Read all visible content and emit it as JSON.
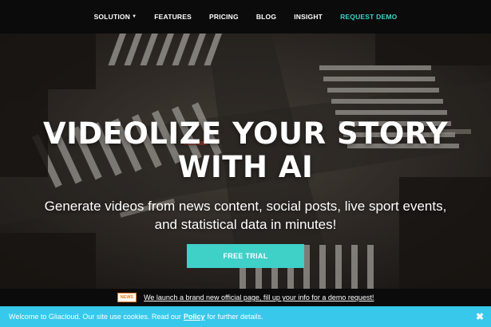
{
  "nav": {
    "items": [
      {
        "label": "SOLUTION",
        "has_dropdown": true
      },
      {
        "label": "FEATURES"
      },
      {
        "label": "PRICING"
      },
      {
        "label": "BLOG"
      },
      {
        "label": "INSIGHT"
      },
      {
        "label": "REQUEST DEMO",
        "accent": true
      }
    ]
  },
  "hero": {
    "headline_line1": "VIDEOLIZE YOUR STORY",
    "headline_line2": "WITH AI",
    "subtext_line1": "Generate videos from news content, social posts, live sport events,",
    "subtext_line2": "and statistical data in minutes!",
    "cta_label": "FREE TRIAL"
  },
  "announcement": {
    "badge": "NEWS",
    "text": "We launch a brand new official page, fill up your info for a demo request!"
  },
  "cookie_bar": {
    "text_before": "Welcome to Gliacloud. Our site use cookies. Read our",
    "policy_link": "Policy",
    "text_after": "for further details.",
    "close": "✖"
  },
  "colors": {
    "accent": "#3fd0c8",
    "cookie_bar": "#37c8ec",
    "nav_bg": "#0b0b0b"
  }
}
